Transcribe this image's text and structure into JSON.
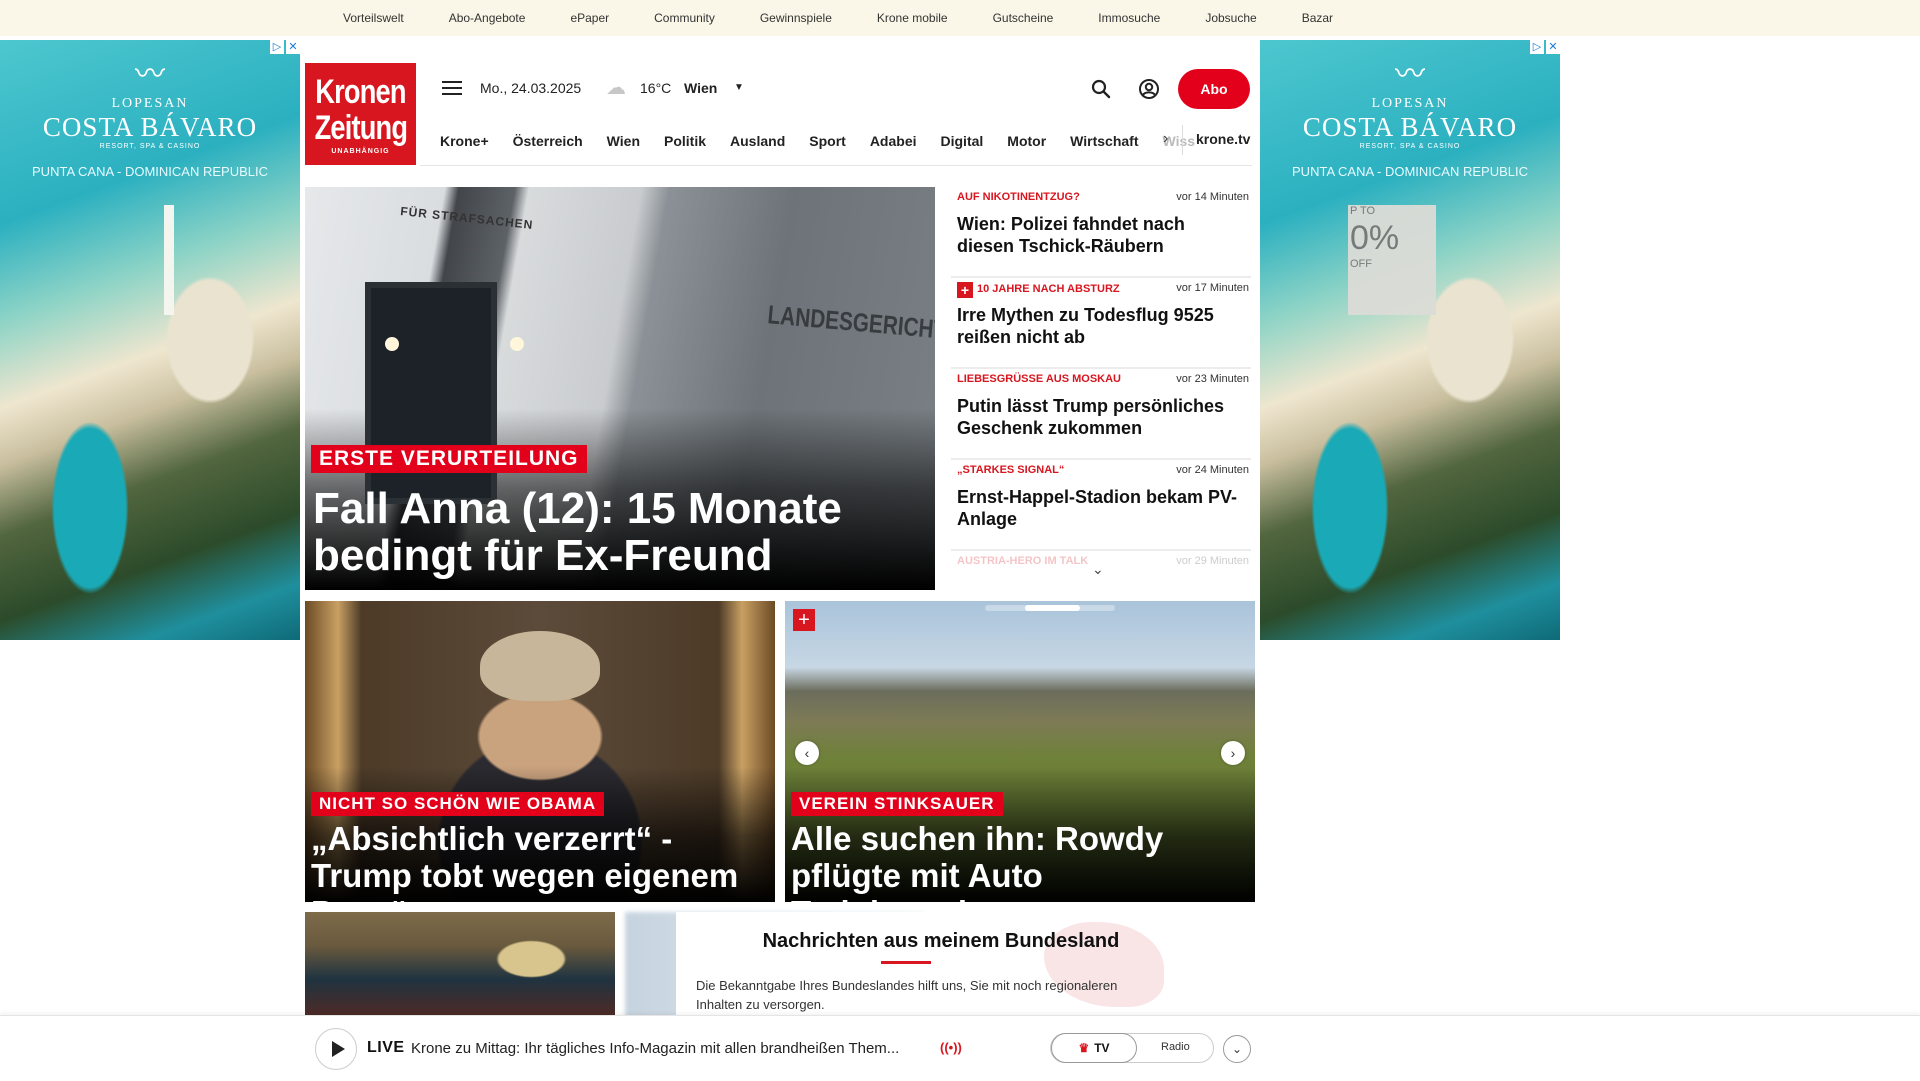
{
  "top_links": [
    "Vorteilswelt",
    "Abo-Angebote",
    "ePaper",
    "Community",
    "Gewinnspiele",
    "Krone mobile",
    "Gutscheine",
    "Immosuche",
    "Jobsuche",
    "Bazar"
  ],
  "ad": {
    "brand": "LOPESAN",
    "name": "COSTA BÁVARO",
    "tagline": "RESORT, SPA & CASINO",
    "location": "PUNTA CANA - DOMINICAN REPUBLIC",
    "promo_top": "P TO",
    "promo_big": "0%",
    "promo_bottom": "OFF",
    "choice_i": "▷",
    "choice_x": "✕"
  },
  "header": {
    "logo_line1": "Kronen",
    "logo_line2": "Zeitung",
    "logo_sub": "UNABHÄNGIG",
    "date": "Mo., 24.03.2025",
    "temperature": "16°C",
    "city": "Wien",
    "abo_label": "Abo",
    "nav": [
      "Krone+",
      "Österreich",
      "Wien",
      "Politik",
      "Ausland",
      "Sport",
      "Adabei",
      "Digital",
      "Motor",
      "Wirtschaft"
    ],
    "nav_more": "Wiss",
    "krone_tv": "krone.tv"
  },
  "hero": {
    "kicker": "ERSTE VERURTEILUNG",
    "headline": "Fall Anna (12): 15 Monate bedingt für Ex-Freund",
    "sign1": "FÜR STRAFSACHEN",
    "sign2": "LANDESGERICHT"
  },
  "side_list": [
    {
      "kicker": "AUF NIKOTINENTZUG?",
      "time": "vor 14 Minuten",
      "headline": "Wien: Polizei fahndet nach diesen Tschick-Räubern",
      "plus": false
    },
    {
      "kicker": "10 JAHRE NACH ABSTURZ",
      "time": "vor 17 Minuten",
      "headline": "Irre Mythen zu Todesflug 9525 reißen nicht ab",
      "plus": true
    },
    {
      "kicker": "LIEBESGRÜSSE AUS MOSKAU",
      "time": "vor 23 Minuten",
      "headline": "Putin lässt Trump persönliches Geschenk zukommen",
      "plus": false
    },
    {
      "kicker": "„STARKES SIGNAL“",
      "time": "vor 24 Minuten",
      "headline": "Ernst-Happel-Stadion bekam PV-Anlage",
      "plus": false
    },
    {
      "kicker": "AUSTRIA-HERO IM TALK",
      "time": "vor 29 Minuten",
      "headline": "",
      "plus": false
    }
  ],
  "cards": [
    {
      "kicker": "NICHT SO SCHÖN WIE OBAMA",
      "headline": "„Absichtlich verzerrt“ - Trump tobt wegen eigenem Porträt"
    },
    {
      "kicker": "VEREIN STINKSAUER",
      "headline": "Alle suchen ihn: Rowdy pflügte mit Auto Trainingsplatz um"
    }
  ],
  "bundesland": {
    "title": "Nachrichten aus meinem Bundesland",
    "text": "Die Bekanntgabe Ihres Bundeslandes hilft uns, Sie mit noch regionaleren Inhalten zu versorgen."
  },
  "player": {
    "live_label": "LIVE",
    "title": "Krone zu Mittag: Ihr tägliches Info-Magazin mit allen brandheißen Them...",
    "broadcast": "((•))",
    "tv_label": "TV",
    "radio_label": "Radio"
  }
}
